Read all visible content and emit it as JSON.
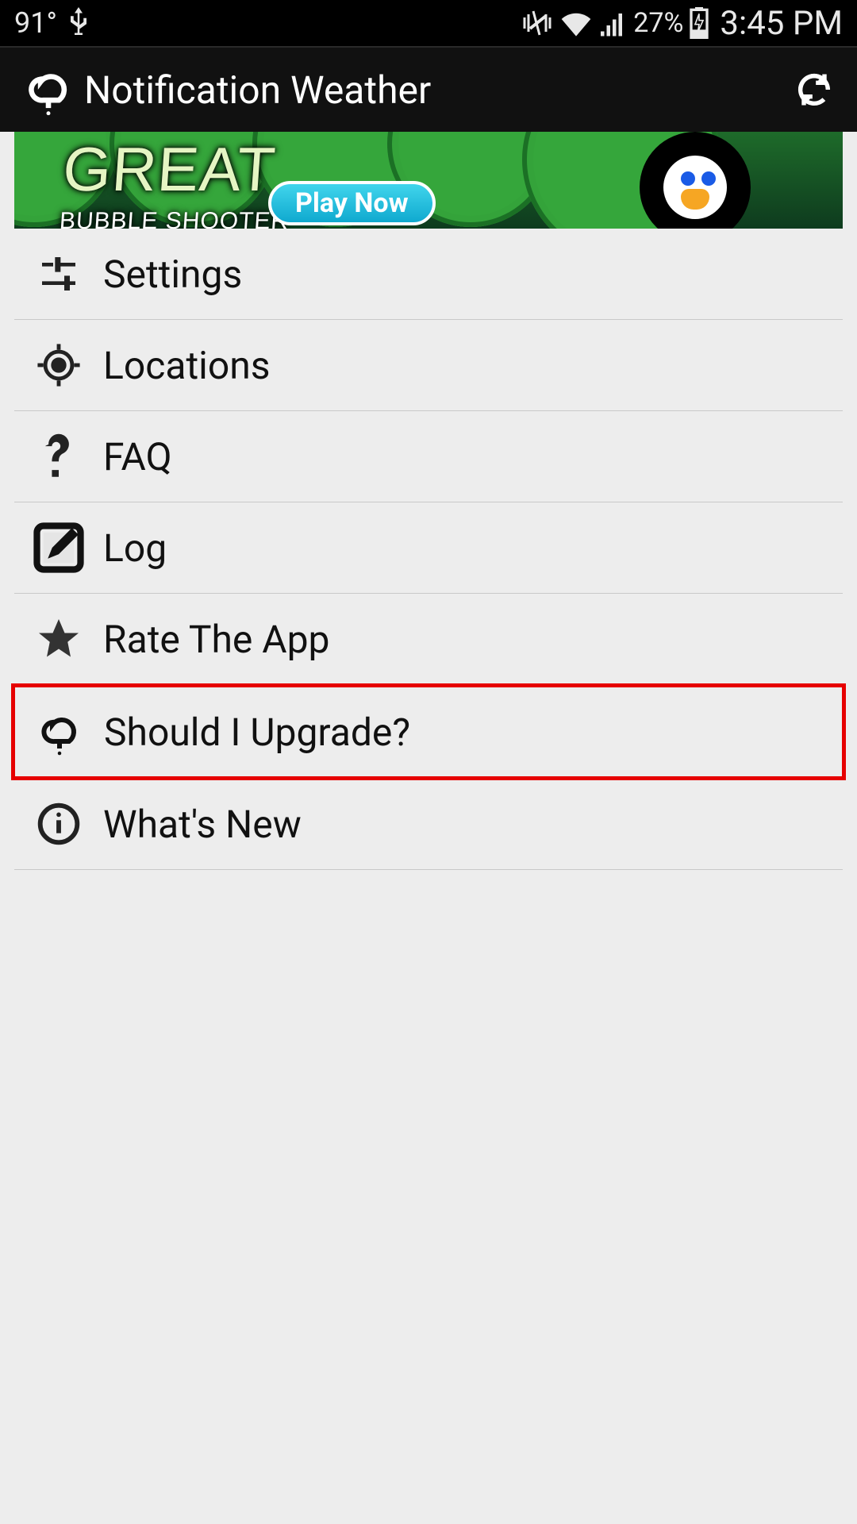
{
  "status_bar": {
    "temperature": "91°",
    "battery_percent": "27%",
    "time": "3:45 PM"
  },
  "app_bar": {
    "title": "Notification Weather"
  },
  "ad": {
    "title_line1": "GREAT",
    "title_line2": "BUBBLE SHOOTER",
    "cta": "Play Now"
  },
  "menu": {
    "settings": "Settings",
    "locations": "Locations",
    "faq": "FAQ",
    "log": "Log",
    "rate": "Rate The App",
    "upgrade": "Should I Upgrade?",
    "whats_new": "What's New"
  }
}
